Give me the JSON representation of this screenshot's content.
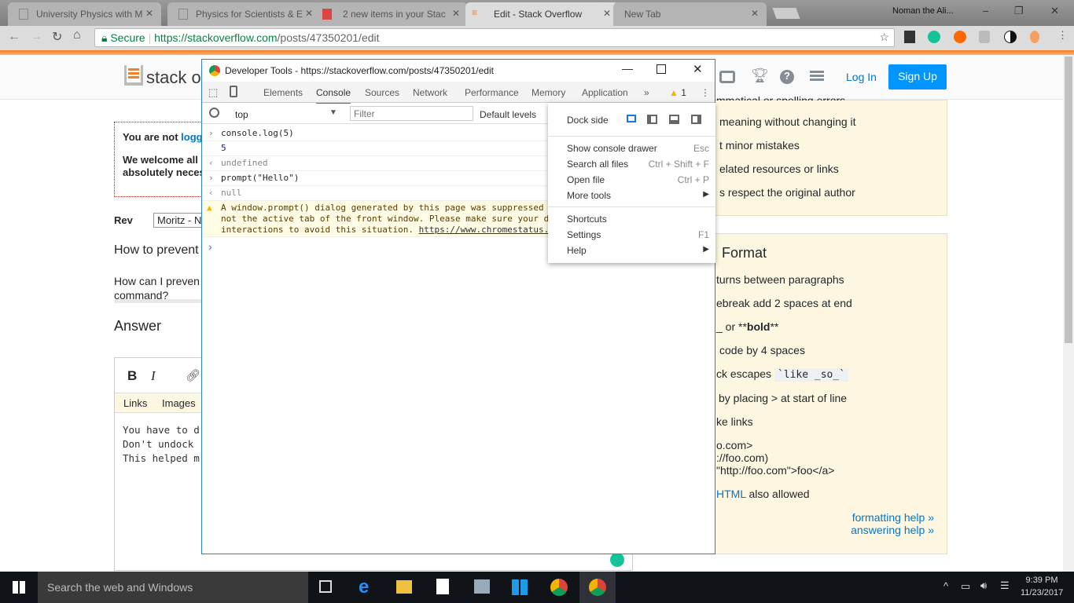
{
  "browser": {
    "tabs": [
      {
        "label": "University Physics with M"
      },
      {
        "label": "Physics for Scientists & E"
      },
      {
        "label": "2 new items in your Stac"
      },
      {
        "label": "Edit - Stack Overflow",
        "active": true
      },
      {
        "label": "New Tab"
      }
    ],
    "profile": "Noman the Ali...",
    "secure_label": "Secure",
    "url_host": "https://stackoverflow.com",
    "url_path": "/posts/47350201/edit"
  },
  "so": {
    "logo_text": "stack ove",
    "login": "Log In",
    "signup": "Sign Up",
    "notice_line1": "You are not ",
    "notice_link": "logg",
    "notice_line2": "We welcome all",
    "notice_line3": "absolutely neces",
    "rev_label": "Rev",
    "rev_value": "Moritz - N",
    "question_title": "How to prevent",
    "question_body1": "How can I preven",
    "question_body2": "command?",
    "answer_heading": "Answer",
    "bold": "B",
    "italic": "I",
    "tab_links": "Links",
    "tab_images": "Images",
    "answer_lines": [
      "You have to d",
      "Don't undock",
      "This helped m"
    ],
    "sidebar1": [
      "mmatical or spelling errors",
      "meaning without changing it",
      "t minor mistakes",
      "elated resources or links",
      "s respect the original author"
    ],
    "sidebar2_title": "Format",
    "sidebar2": [
      "turns between paragraphs",
      "ebreak add 2 spaces at end",
      "_ or **",
      "code by 4 spaces",
      "ck escapes ",
      "by placing > at start of line",
      "ke links",
      "o.com>",
      "://foo.com)",
      "\"http://foo.com\">foo</a>"
    ],
    "bold_word": "bold",
    "bold_tail": "**",
    "code_sample": "`like _so_`",
    "html_link": "HTML",
    "html_tail": " also allowed",
    "formatting_help": "formatting help »",
    "answering_help": "answering help »"
  },
  "devtools": {
    "title": "Developer Tools - https://stackoverflow.com/posts/47350201/edit",
    "tabs": [
      "Elements",
      "Console",
      "Sources",
      "Network",
      "Performance",
      "Memory",
      "Application"
    ],
    "active_tab": "Console",
    "warning_count": "1",
    "context": "top",
    "filter_placeholder": "Filter",
    "levels": "Default levels",
    "console": [
      {
        "type": "input",
        "text": "console.log(5)"
      },
      {
        "type": "log",
        "text": "5"
      },
      {
        "type": "result",
        "text": "undefined"
      },
      {
        "type": "input",
        "text": "prompt(\"Hello\")"
      },
      {
        "type": "result",
        "text": "null"
      }
    ],
    "warning": [
      "A window.prompt() dialog generated by this page was suppressed b",
      "not the active tab of the front window. Please make sure your d",
      "interactions to avoid this situation. "
    ],
    "warning_link": "https://www.chromestatus.c",
    "menu": {
      "dock_side": "Dock side",
      "items": [
        {
          "label": "Show console drawer",
          "shortcut": "Esc"
        },
        {
          "label": "Search all files",
          "shortcut": "Ctrl + Shift + F"
        },
        {
          "label": "Open file",
          "shortcut": "Ctrl + P"
        },
        {
          "label": "More tools",
          "shortcut": "▶"
        },
        {
          "label": "Shortcuts",
          "shortcut": ""
        },
        {
          "label": "Settings",
          "shortcut": "F1"
        },
        {
          "label": "Help",
          "shortcut": "▶"
        }
      ]
    }
  },
  "taskbar": {
    "search": "Search the web and Windows",
    "time": "9:39 PM",
    "date": "11/23/2017"
  },
  "colors": {
    "accent": "#f48024",
    "link": "#0077cc",
    "signup": "#0095ff",
    "devtools_blue": "#1a73e8"
  }
}
